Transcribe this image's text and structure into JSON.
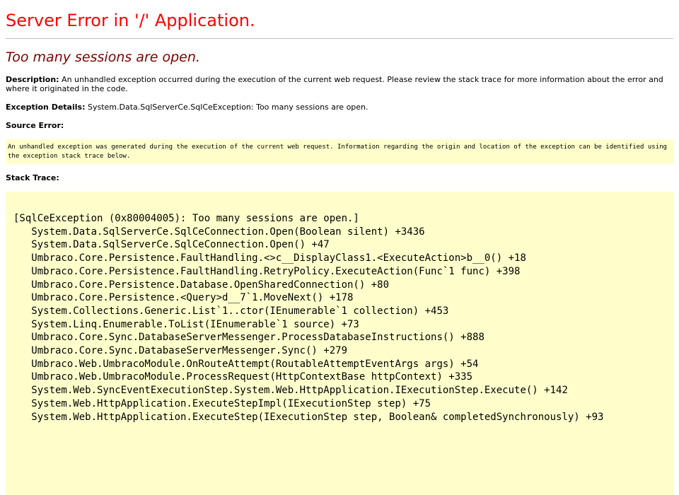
{
  "page": {
    "title": "Server Error in '/' Application.",
    "subtitle": "Too many sessions are open."
  },
  "description": {
    "label": "Description:",
    "text": " An unhandled exception occurred during the execution of the current web request. Please review the stack trace for more information about the error and where it originated in the code."
  },
  "exception_details": {
    "label": "Exception Details:",
    "text": " System.Data.SqlServerCe.SqlCeException: Too many sessions are open."
  },
  "source_error": {
    "label": "Source Error:",
    "text": "An unhandled exception was generated during the execution of the current web request. Information regarding the origin and location of the exception can be identified using the exception stack trace below."
  },
  "stack_trace": {
    "label": "Stack Trace:",
    "lines": [
      "[SqlCeException (0x80004005): Too many sessions are open.]",
      "   System.Data.SqlServerCe.SqlCeConnection.Open(Boolean silent) +3436",
      "   System.Data.SqlServerCe.SqlCeConnection.Open() +47",
      "   Umbraco.Core.Persistence.FaultHandling.<>c__DisplayClass1.<ExecuteAction>b__0() +18",
      "   Umbraco.Core.Persistence.FaultHandling.RetryPolicy.ExecuteAction(Func`1 func) +398",
      "   Umbraco.Core.Persistence.Database.OpenSharedConnection() +80",
      "   Umbraco.Core.Persistence.<Query>d__7`1.MoveNext() +178",
      "   System.Collections.Generic.List`1..ctor(IEnumerable`1 collection) +453",
      "   System.Linq.Enumerable.ToList(IEnumerable`1 source) +73",
      "   Umbraco.Core.Sync.DatabaseServerMessenger.ProcessDatabaseInstructions() +888",
      "   Umbraco.Core.Sync.DatabaseServerMessenger.Sync() +279",
      "   Umbraco.Web.UmbracoModule.OnRouteAttempt(RoutableAttemptEventArgs args) +54",
      "   Umbraco.Web.UmbracoModule.ProcessRequest(HttpContextBase httpContext) +335",
      "   System.Web.SyncEventExecutionStep.System.Web.HttpApplication.IExecutionStep.Execute() +142",
      "   System.Web.HttpApplication.ExecuteStepImpl(IExecutionStep step) +75",
      "   System.Web.HttpApplication.ExecuteStep(IExecutionStep step, Boolean& completedSynchronously) +93"
    ]
  },
  "colors": {
    "title": "#ff0000",
    "subtitle": "#800000",
    "code_background": "#ffffcc"
  }
}
